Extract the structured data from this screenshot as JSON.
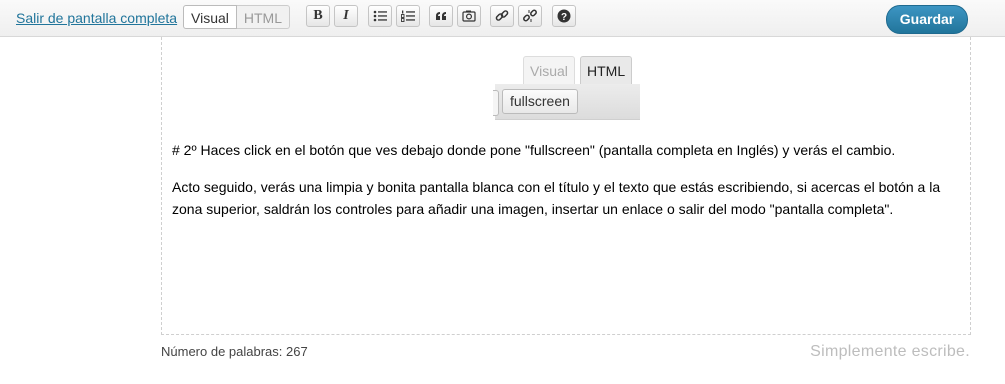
{
  "toolbar": {
    "exit_link": "Salir de pantalla completa",
    "tabs": [
      {
        "label": "Visual",
        "active": true
      },
      {
        "label": "HTML",
        "active": false
      }
    ],
    "buttons": {
      "bold": "B",
      "italic": "I",
      "icons": [
        "bold-icon",
        "italic-icon",
        "bulleted-list-icon",
        "numbered-list-icon",
        "blockquote-icon",
        "insert-media-icon",
        "insert-link-icon",
        "remove-link-icon",
        "help-icon"
      ]
    },
    "save_label": "Guardar",
    "save_color": "#21759b"
  },
  "editor": {
    "embedded_screenshot": {
      "tab_visual": "Visual",
      "tab_html": "HTML",
      "button": "fullscreen"
    },
    "paragraphs": [
      "# 2º Haces click en el botón que ves debajo donde pone \"fullscreen\" (pantalla completa en Inglés) y verás el cambio.",
      "Acto seguido, verás una limpia y bonita pantalla blanca con el título y el texto que estás escribiendo, si acercas el botón a la zona superior, saldrán los controles para añadir una imagen, insertar un enlace o salir del modo \"pantalla completa\"."
    ]
  },
  "footer": {
    "word_count": "Número de palabras: 267",
    "tagline": "Simplemente escribe."
  }
}
